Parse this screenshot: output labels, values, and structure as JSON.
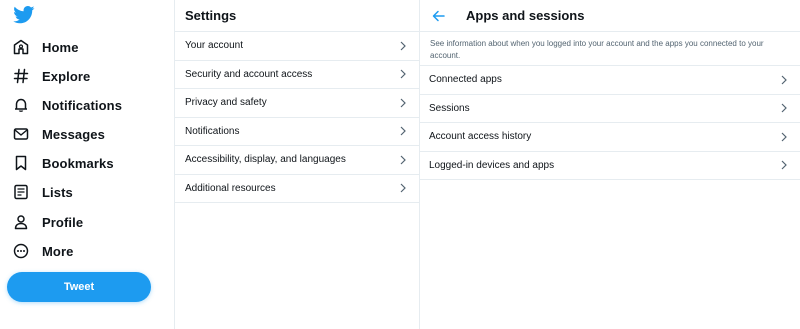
{
  "nav": {
    "items": [
      {
        "label": "Home",
        "icon": "home-icon"
      },
      {
        "label": "Explore",
        "icon": "hashtag-icon"
      },
      {
        "label": "Notifications",
        "icon": "bell-icon"
      },
      {
        "label": "Messages",
        "icon": "envelope-icon"
      },
      {
        "label": "Bookmarks",
        "icon": "bookmark-icon"
      },
      {
        "label": "Lists",
        "icon": "list-icon"
      },
      {
        "label": "Profile",
        "icon": "person-icon"
      },
      {
        "label": "More",
        "icon": "more-icon"
      }
    ],
    "tweet_label": "Tweet"
  },
  "settings": {
    "title": "Settings",
    "items": [
      "Your account",
      "Security and account access",
      "Privacy and safety",
      "Notifications",
      "Accessibility, display, and languages",
      "Additional resources"
    ]
  },
  "apps": {
    "title": "Apps and sessions",
    "description": "See information about when you logged into your account and the apps you connected to your account.",
    "items": [
      "Connected apps",
      "Sessions",
      "Account access history",
      "Logged-in devices and apps"
    ]
  },
  "colors": {
    "accent": "#1d9bf0",
    "text": "#0f1419",
    "secondary_text": "#536471",
    "border": "#e6ecf0"
  }
}
